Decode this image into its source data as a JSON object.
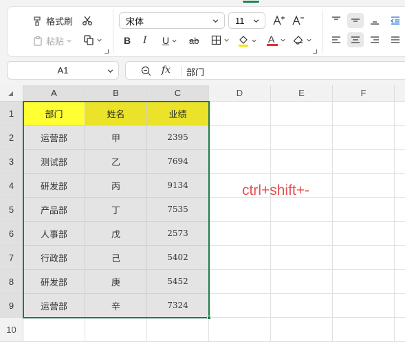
{
  "ribbon": {
    "format_painter_label": "格式刷",
    "paste_label": "粘贴",
    "font_name": "宋体",
    "font_size": "11",
    "bold_label": "B",
    "italic_label": "I",
    "underline_label": "U",
    "strike_label": "ab",
    "font_color_label": "A",
    "font_color": "#e03131",
    "fill_color": "#f5e600"
  },
  "formula": {
    "name_box": "A1",
    "fx_label": "fx",
    "content": "部门"
  },
  "grid": {
    "columns": [
      "A",
      "B",
      "C",
      "D",
      "E",
      "F"
    ],
    "rows": [
      "1",
      "2",
      "3",
      "4",
      "5",
      "6",
      "7",
      "8",
      "9",
      "10"
    ],
    "header_colors": [
      "#ffff33",
      "#ebe32a",
      "#ebe32a"
    ],
    "data": [
      [
        "部门",
        "姓名",
        "业绩"
      ],
      [
        "运营部",
        "甲",
        "2395"
      ],
      [
        "测试部",
        "乙",
        "7694"
      ],
      [
        "研发部",
        "丙",
        "9134"
      ],
      [
        "产品部",
        "丁",
        "7535"
      ],
      [
        "人事部",
        "戊",
        "2573"
      ],
      [
        "行政部",
        "己",
        "5402"
      ],
      [
        "研发部",
        "庚",
        "5452"
      ],
      [
        "运营部",
        "辛",
        "7324"
      ]
    ]
  },
  "annotation": {
    "shortcut_text": "ctrl+shift+-",
    "color": "#e84f4f"
  },
  "accent_color": "#1f7a45"
}
